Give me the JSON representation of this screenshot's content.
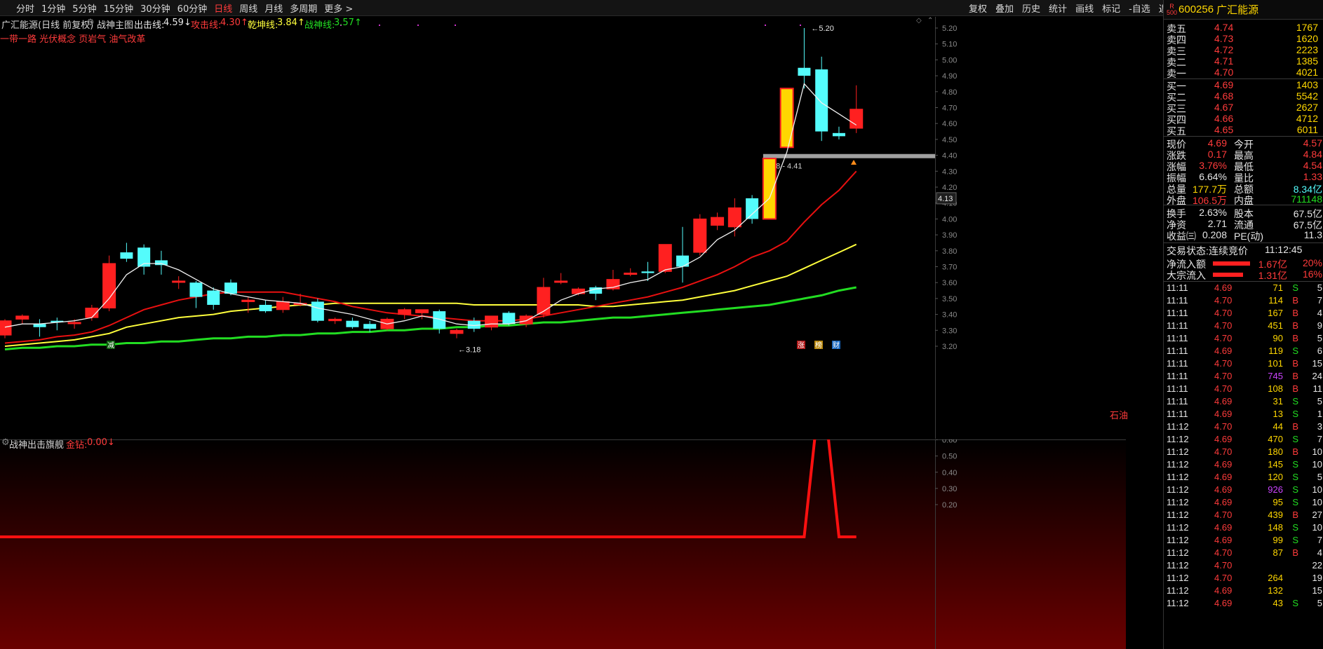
{
  "toolbar": {
    "periods": [
      "分时",
      "1分钟",
      "5分钟",
      "15分钟",
      "30分钟",
      "60分钟",
      "日线",
      "周线",
      "月线",
      "多周期",
      "更多 >"
    ],
    "active_period": "日线",
    "tools": [
      "复权",
      "叠加",
      "历史",
      "统计",
      "画线",
      "标记",
      "-自选",
      "返回"
    ]
  },
  "main": {
    "title": "广汇能源(日线 前复权)",
    "indicator": "战神主图",
    "line1_label": "出击线:",
    "line1_value": "4.59↓",
    "line2_label": "攻击线:",
    "line2_value": "4.30↑",
    "line3_label": "乾坤线:",
    "line3_value": "3.84↑",
    "line4_label": "战神线:",
    "line4_value": "3.57↑",
    "concepts": "一带一路 光伏概念 页岩气 油气改革",
    "high_mark": "5.20",
    "low_mark": "3.18",
    "range_label": "4.38 - 4.41",
    "price_tag": "4.13",
    "signal_left": "减",
    "signal_right": [
      "涨",
      "榜",
      "财"
    ],
    "corner_label": "石油",
    "colors": {
      "up": "#ff2020",
      "down": "#54fcfc",
      "ma_red": "#e81010",
      "ma_yellow": "#ffff3c",
      "ma_green": "#22dd22",
      "ma_white": "#f0f0f0",
      "signal": "#ffd700"
    }
  },
  "sub": {
    "indicator": "战神出击旗舰",
    "label": "金钻:",
    "value": "0.00↓"
  },
  "chart_data": [
    {
      "type": "candlestick",
      "title": "",
      "ylim": [
        3.13,
        5.26
      ],
      "y_ticks": [
        5.2,
        5.1,
        5.0,
        4.9,
        4.8,
        4.7,
        4.6,
        4.5,
        4.4,
        4.3,
        4.2,
        4.1,
        4.0,
        3.9,
        3.8,
        3.7,
        3.6,
        3.5,
        3.4,
        3.3,
        3.2
      ],
      "candles": [
        {
          "o": 3.27,
          "h": 3.37,
          "l": 3.25,
          "c": 3.36
        },
        {
          "o": 3.37,
          "h": 3.4,
          "l": 3.34,
          "c": 3.39
        },
        {
          "o": 3.34,
          "h": 3.37,
          "l": 3.26,
          "c": 3.32
        },
        {
          "o": 3.36,
          "h": 3.38,
          "l": 3.3,
          "c": 3.35
        },
        {
          "o": 3.35,
          "h": 3.37,
          "l": 3.31,
          "c": 3.35
        },
        {
          "o": 3.38,
          "h": 3.46,
          "l": 3.36,
          "c": 3.44
        },
        {
          "o": 3.44,
          "h": 3.77,
          "l": 3.42,
          "c": 3.72
        },
        {
          "o": 3.79,
          "h": 3.85,
          "l": 3.73,
          "c": 3.75
        },
        {
          "o": 3.82,
          "h": 3.84,
          "l": 3.65,
          "c": 3.7
        },
        {
          "o": 3.74,
          "h": 3.8,
          "l": 3.65,
          "c": 3.71
        },
        {
          "o": 3.61,
          "h": 3.64,
          "l": 3.56,
          "c": 3.61
        },
        {
          "o": 3.6,
          "h": 3.61,
          "l": 3.44,
          "c": 3.51
        },
        {
          "o": 3.55,
          "h": 3.57,
          "l": 3.43,
          "c": 3.46
        },
        {
          "o": 3.6,
          "h": 3.62,
          "l": 3.52,
          "c": 3.53
        },
        {
          "o": 3.48,
          "h": 3.51,
          "l": 3.41,
          "c": 3.49
        },
        {
          "o": 3.46,
          "h": 3.49,
          "l": 3.41,
          "c": 3.42
        },
        {
          "o": 3.43,
          "h": 3.51,
          "l": 3.41,
          "c": 3.48
        },
        {
          "o": 3.47,
          "h": 3.53,
          "l": 3.45,
          "c": 3.47
        },
        {
          "o": 3.48,
          "h": 3.5,
          "l": 3.35,
          "c": 3.36
        },
        {
          "o": 3.36,
          "h": 3.38,
          "l": 3.34,
          "c": 3.37
        },
        {
          "o": 3.36,
          "h": 3.38,
          "l": 3.31,
          "c": 3.32
        },
        {
          "o": 3.34,
          "h": 3.36,
          "l": 3.29,
          "c": 3.31
        },
        {
          "o": 3.31,
          "h": 3.38,
          "l": 3.3,
          "c": 3.37
        },
        {
          "o": 3.4,
          "h": 3.44,
          "l": 3.37,
          "c": 3.43
        },
        {
          "o": 3.41,
          "h": 3.43,
          "l": 3.37,
          "c": 3.43
        },
        {
          "o": 3.42,
          "h": 3.43,
          "l": 3.28,
          "c": 3.31
        },
        {
          "o": 3.28,
          "h": 3.31,
          "l": 3.25,
          "c": 3.3
        },
        {
          "o": 3.36,
          "h": 3.38,
          "l": 3.29,
          "c": 3.31
        },
        {
          "o": 3.32,
          "h": 3.39,
          "l": 3.3,
          "c": 3.39
        },
        {
          "o": 3.41,
          "h": 3.42,
          "l": 3.33,
          "c": 3.34
        },
        {
          "o": 3.34,
          "h": 3.4,
          "l": 3.32,
          "c": 3.39
        },
        {
          "o": 3.4,
          "h": 3.63,
          "l": 3.38,
          "c": 3.57
        },
        {
          "o": 3.61,
          "h": 3.66,
          "l": 3.59,
          "c": 3.61
        },
        {
          "o": 3.53,
          "h": 3.57,
          "l": 3.52,
          "c": 3.56
        },
        {
          "o": 3.57,
          "h": 3.58,
          "l": 3.49,
          "c": 3.53
        },
        {
          "o": 3.56,
          "h": 3.68,
          "l": 3.55,
          "c": 3.62
        },
        {
          "o": 3.66,
          "h": 3.69,
          "l": 3.64,
          "c": 3.66
        },
        {
          "o": 3.67,
          "h": 3.73,
          "l": 3.61,
          "c": 3.66
        },
        {
          "o": 3.67,
          "h": 3.84,
          "l": 3.66,
          "c": 3.84
        },
        {
          "o": 3.77,
          "h": 3.95,
          "l": 3.6,
          "c": 3.7
        },
        {
          "o": 3.79,
          "h": 4.03,
          "l": 3.77,
          "c": 4.0
        },
        {
          "o": 3.96,
          "h": 4.04,
          "l": 3.93,
          "c": 4.01
        },
        {
          "o": 3.95,
          "h": 4.13,
          "l": 3.89,
          "c": 4.07
        },
        {
          "o": 4.13,
          "h": 4.15,
          "l": 3.97,
          "c": 4.0
        },
        {
          "o": 4.0,
          "h": 4.38,
          "l": 4.0,
          "c": 4.38
        },
        {
          "o": 4.45,
          "h": 4.82,
          "l": 4.45,
          "c": 4.82
        },
        {
          "o": 4.95,
          "h": 5.2,
          "l": 4.82,
          "c": 4.9
        },
        {
          "o": 4.94,
          "h": 5.02,
          "l": 4.49,
          "c": 4.55
        },
        {
          "o": 4.54,
          "h": 4.58,
          "l": 4.5,
          "c": 4.52
        },
        {
          "o": 4.57,
          "h": 4.84,
          "l": 4.54,
          "c": 4.69
        }
      ],
      "signal_candles": [
        44,
        45
      ],
      "ma_white": [
        3.32,
        3.34,
        3.34,
        3.35,
        3.36,
        3.38,
        3.5,
        3.65,
        3.72,
        3.72,
        3.68,
        3.62,
        3.56,
        3.53,
        3.51,
        3.49,
        3.48,
        3.47,
        3.44,
        3.42,
        3.4,
        3.37,
        3.34,
        3.36,
        3.39,
        3.37,
        3.34,
        3.33,
        3.34,
        3.34,
        3.36,
        3.42,
        3.49,
        3.53,
        3.56,
        3.57,
        3.6,
        3.62,
        3.68,
        3.7,
        3.76,
        3.87,
        3.93,
        4.03,
        4.13,
        4.42,
        4.85,
        4.73,
        4.66,
        4.59
      ],
      "ma_red": [
        3.22,
        3.23,
        3.24,
        3.26,
        3.27,
        3.29,
        3.33,
        3.38,
        3.43,
        3.46,
        3.49,
        3.51,
        3.53,
        3.54,
        3.54,
        3.54,
        3.54,
        3.52,
        3.5,
        3.48,
        3.45,
        3.43,
        3.41,
        3.4,
        3.39,
        3.38,
        3.37,
        3.36,
        3.36,
        3.36,
        3.37,
        3.39,
        3.41,
        3.43,
        3.45,
        3.47,
        3.49,
        3.51,
        3.54,
        3.57,
        3.61,
        3.65,
        3.7,
        3.76,
        3.8,
        3.86,
        3.98,
        4.09,
        4.18,
        4.3
      ],
      "ma_yellow": [
        3.2,
        3.21,
        3.22,
        3.23,
        3.24,
        3.26,
        3.28,
        3.32,
        3.34,
        3.36,
        3.38,
        3.39,
        3.4,
        3.42,
        3.43,
        3.44,
        3.45,
        3.46,
        3.46,
        3.47,
        3.47,
        3.47,
        3.47,
        3.47,
        3.47,
        3.47,
        3.47,
        3.46,
        3.46,
        3.46,
        3.46,
        3.46,
        3.46,
        3.46,
        3.45,
        3.45,
        3.46,
        3.47,
        3.48,
        3.49,
        3.51,
        3.53,
        3.55,
        3.58,
        3.61,
        3.64,
        3.69,
        3.74,
        3.79,
        3.84
      ],
      "ma_green": [
        3.18,
        3.19,
        3.19,
        3.2,
        3.2,
        3.21,
        3.21,
        3.22,
        3.22,
        3.23,
        3.23,
        3.24,
        3.25,
        3.25,
        3.26,
        3.26,
        3.27,
        3.27,
        3.28,
        3.28,
        3.29,
        3.29,
        3.3,
        3.3,
        3.31,
        3.31,
        3.32,
        3.32,
        3.33,
        3.33,
        3.34,
        3.35,
        3.35,
        3.36,
        3.37,
        3.38,
        3.38,
        3.39,
        3.4,
        3.41,
        3.42,
        3.43,
        3.44,
        3.45,
        3.46,
        3.48,
        3.5,
        3.52,
        3.55,
        3.57
      ]
    },
    {
      "type": "line",
      "title": "",
      "ylim": [
        0,
        1.02
      ],
      "y_ticks": [
        1.0,
        0.9,
        0.8,
        0.7,
        0.6,
        0.5,
        0.4,
        0.3,
        0.2
      ],
      "values": [
        0,
        0,
        0,
        0,
        0,
        0,
        0,
        0,
        0,
        0,
        0,
        0,
        0,
        0,
        0,
        0,
        0,
        0,
        0,
        0,
        0,
        0,
        0,
        0,
        0,
        0,
        0,
        0,
        0,
        0,
        0,
        0,
        0,
        0,
        0,
        0,
        0,
        0,
        0,
        0,
        0,
        0,
        0,
        0,
        0,
        0,
        0,
        1,
        0,
        0
      ]
    }
  ],
  "quote": {
    "market": "R\n500",
    "code": "600256",
    "name": "广汇能源",
    "asks": [
      {
        "label": "卖五",
        "price": "4.74",
        "vol": "1767"
      },
      {
        "label": "卖四",
        "price": "4.73",
        "vol": "1620"
      },
      {
        "label": "卖三",
        "price": "4.72",
        "vol": "2223"
      },
      {
        "label": "卖二",
        "price": "4.71",
        "vol": "1385"
      },
      {
        "label": "卖一",
        "price": "4.70",
        "vol": "4021"
      }
    ],
    "bids": [
      {
        "label": "买一",
        "price": "4.69",
        "vol": "1403"
      },
      {
        "label": "买二",
        "price": "4.68",
        "vol": "5542"
      },
      {
        "label": "买三",
        "price": "4.67",
        "vol": "2627"
      },
      {
        "label": "买四",
        "price": "4.66",
        "vol": "4712"
      },
      {
        "label": "买五",
        "price": "4.65",
        "vol": "6011"
      }
    ],
    "stats": [
      [
        {
          "k": "现价",
          "v": "4.69",
          "c": "#ff3b3b"
        },
        {
          "k": "今开",
          "v": "4.57",
          "c": "#ff3b3b"
        }
      ],
      [
        {
          "k": "涨跌",
          "v": "0.17",
          "c": "#ff3b3b"
        },
        {
          "k": "最高",
          "v": "4.84",
          "c": "#ff3b3b"
        }
      ],
      [
        {
          "k": "涨幅",
          "v": "3.76%",
          "c": "#ff3b3b"
        },
        {
          "k": "最低",
          "v": "4.54",
          "c": "#ff3b3b"
        }
      ],
      [
        {
          "k": "振幅",
          "v": "6.64%",
          "c": "#e6e6e6"
        },
        {
          "k": "量比",
          "v": "1.33",
          "c": "#ff3b3b"
        }
      ],
      [
        {
          "k": "总量",
          "v": "177.7万",
          "c": "#ffd700"
        },
        {
          "k": "总额",
          "v": "8.34亿",
          "c": "#54fcfc"
        }
      ],
      [
        {
          "k": "外盘",
          "v": "106.5万",
          "c": "#ff3b3b"
        },
        {
          "k": "内盘",
          "v": "711148",
          "c": "#22dd22"
        }
      ],
      [
        {
          "k": "换手",
          "v": "2.63%",
          "c": "#e6e6e6"
        },
        {
          "k": "股本",
          "v": "67.5亿",
          "c": "#e6e6e6"
        }
      ],
      [
        {
          "k": "净资",
          "v": "2.71",
          "c": "#e6e6e6"
        },
        {
          "k": "流通",
          "v": "67.5亿",
          "c": "#e6e6e6"
        }
      ],
      [
        {
          "k": "收益㈢",
          "v": "0.208",
          "c": "#e6e6e6"
        },
        {
          "k": "PE(动)",
          "v": "11.3",
          "c": "#e6e6e6"
        }
      ]
    ],
    "trade_status_label": "交易状态:",
    "trade_status": "连续竞价",
    "trade_time": "11:12:45",
    "flows": [
      {
        "label": "净流入额",
        "value": "1.67亿",
        "pct": "20%",
        "fill": 0.75
      },
      {
        "label": "大宗流入",
        "value": "1.31亿",
        "pct": "16%",
        "fill": 0.62
      }
    ],
    "ticks": [
      {
        "t": "11:11",
        "p": "4.69",
        "v": "71",
        "s": "S",
        "n": "5"
      },
      {
        "t": "11:11",
        "p": "4.70",
        "v": "114",
        "s": "B",
        "n": "7"
      },
      {
        "t": "11:11",
        "p": "4.70",
        "v": "167",
        "s": "B",
        "n": "4"
      },
      {
        "t": "11:11",
        "p": "4.70",
        "v": "451",
        "s": "B",
        "n": "9"
      },
      {
        "t": "11:11",
        "p": "4.70",
        "v": "90",
        "s": "B",
        "n": "5"
      },
      {
        "t": "11:11",
        "p": "4.69",
        "v": "119",
        "s": "S",
        "n": "6"
      },
      {
        "t": "11:11",
        "p": "4.70",
        "v": "101",
        "s": "B",
        "n": "15"
      },
      {
        "t": "11:11",
        "p": "4.70",
        "v": "745",
        "s": "B",
        "n": "24"
      },
      {
        "t": "11:11",
        "p": "4.70",
        "v": "108",
        "s": "B",
        "n": "11"
      },
      {
        "t": "11:11",
        "p": "4.69",
        "v": "31",
        "s": "S",
        "n": "5"
      },
      {
        "t": "11:11",
        "p": "4.69",
        "v": "13",
        "s": "S",
        "n": "1"
      },
      {
        "t": "11:12",
        "p": "4.70",
        "v": "44",
        "s": "B",
        "n": "3"
      },
      {
        "t": "11:12",
        "p": "4.69",
        "v": "470",
        "s": "S",
        "n": "7"
      },
      {
        "t": "11:12",
        "p": "4.70",
        "v": "180",
        "s": "B",
        "n": "10"
      },
      {
        "t": "11:12",
        "p": "4.69",
        "v": "145",
        "s": "S",
        "n": "10"
      },
      {
        "t": "11:12",
        "p": "4.69",
        "v": "120",
        "s": "S",
        "n": "5"
      },
      {
        "t": "11:12",
        "p": "4.69",
        "v": "926",
        "s": "S",
        "n": "10"
      },
      {
        "t": "11:12",
        "p": "4.69",
        "v": "95",
        "s": "S",
        "n": "10"
      },
      {
        "t": "11:12",
        "p": "4.70",
        "v": "439",
        "s": "B",
        "n": "27"
      },
      {
        "t": "11:12",
        "p": "4.69",
        "v": "148",
        "s": "S",
        "n": "10"
      },
      {
        "t": "11:12",
        "p": "4.69",
        "v": "99",
        "s": "S",
        "n": "7"
      },
      {
        "t": "11:12",
        "p": "4.70",
        "v": "87",
        "s": "B",
        "n": "4"
      },
      {
        "t": "11:12",
        "p": "4.70",
        "v": "",
        "s": "",
        "n": "22"
      },
      {
        "t": "11:12",
        "p": "4.70",
        "v": "264",
        "s": "",
        "n": "19"
      },
      {
        "t": "11:12",
        "p": "4.69",
        "v": "132",
        "s": "",
        "n": "15"
      },
      {
        "t": "11:12",
        "p": "4.69",
        "v": "43",
        "s": "S",
        "n": "5"
      }
    ]
  }
}
